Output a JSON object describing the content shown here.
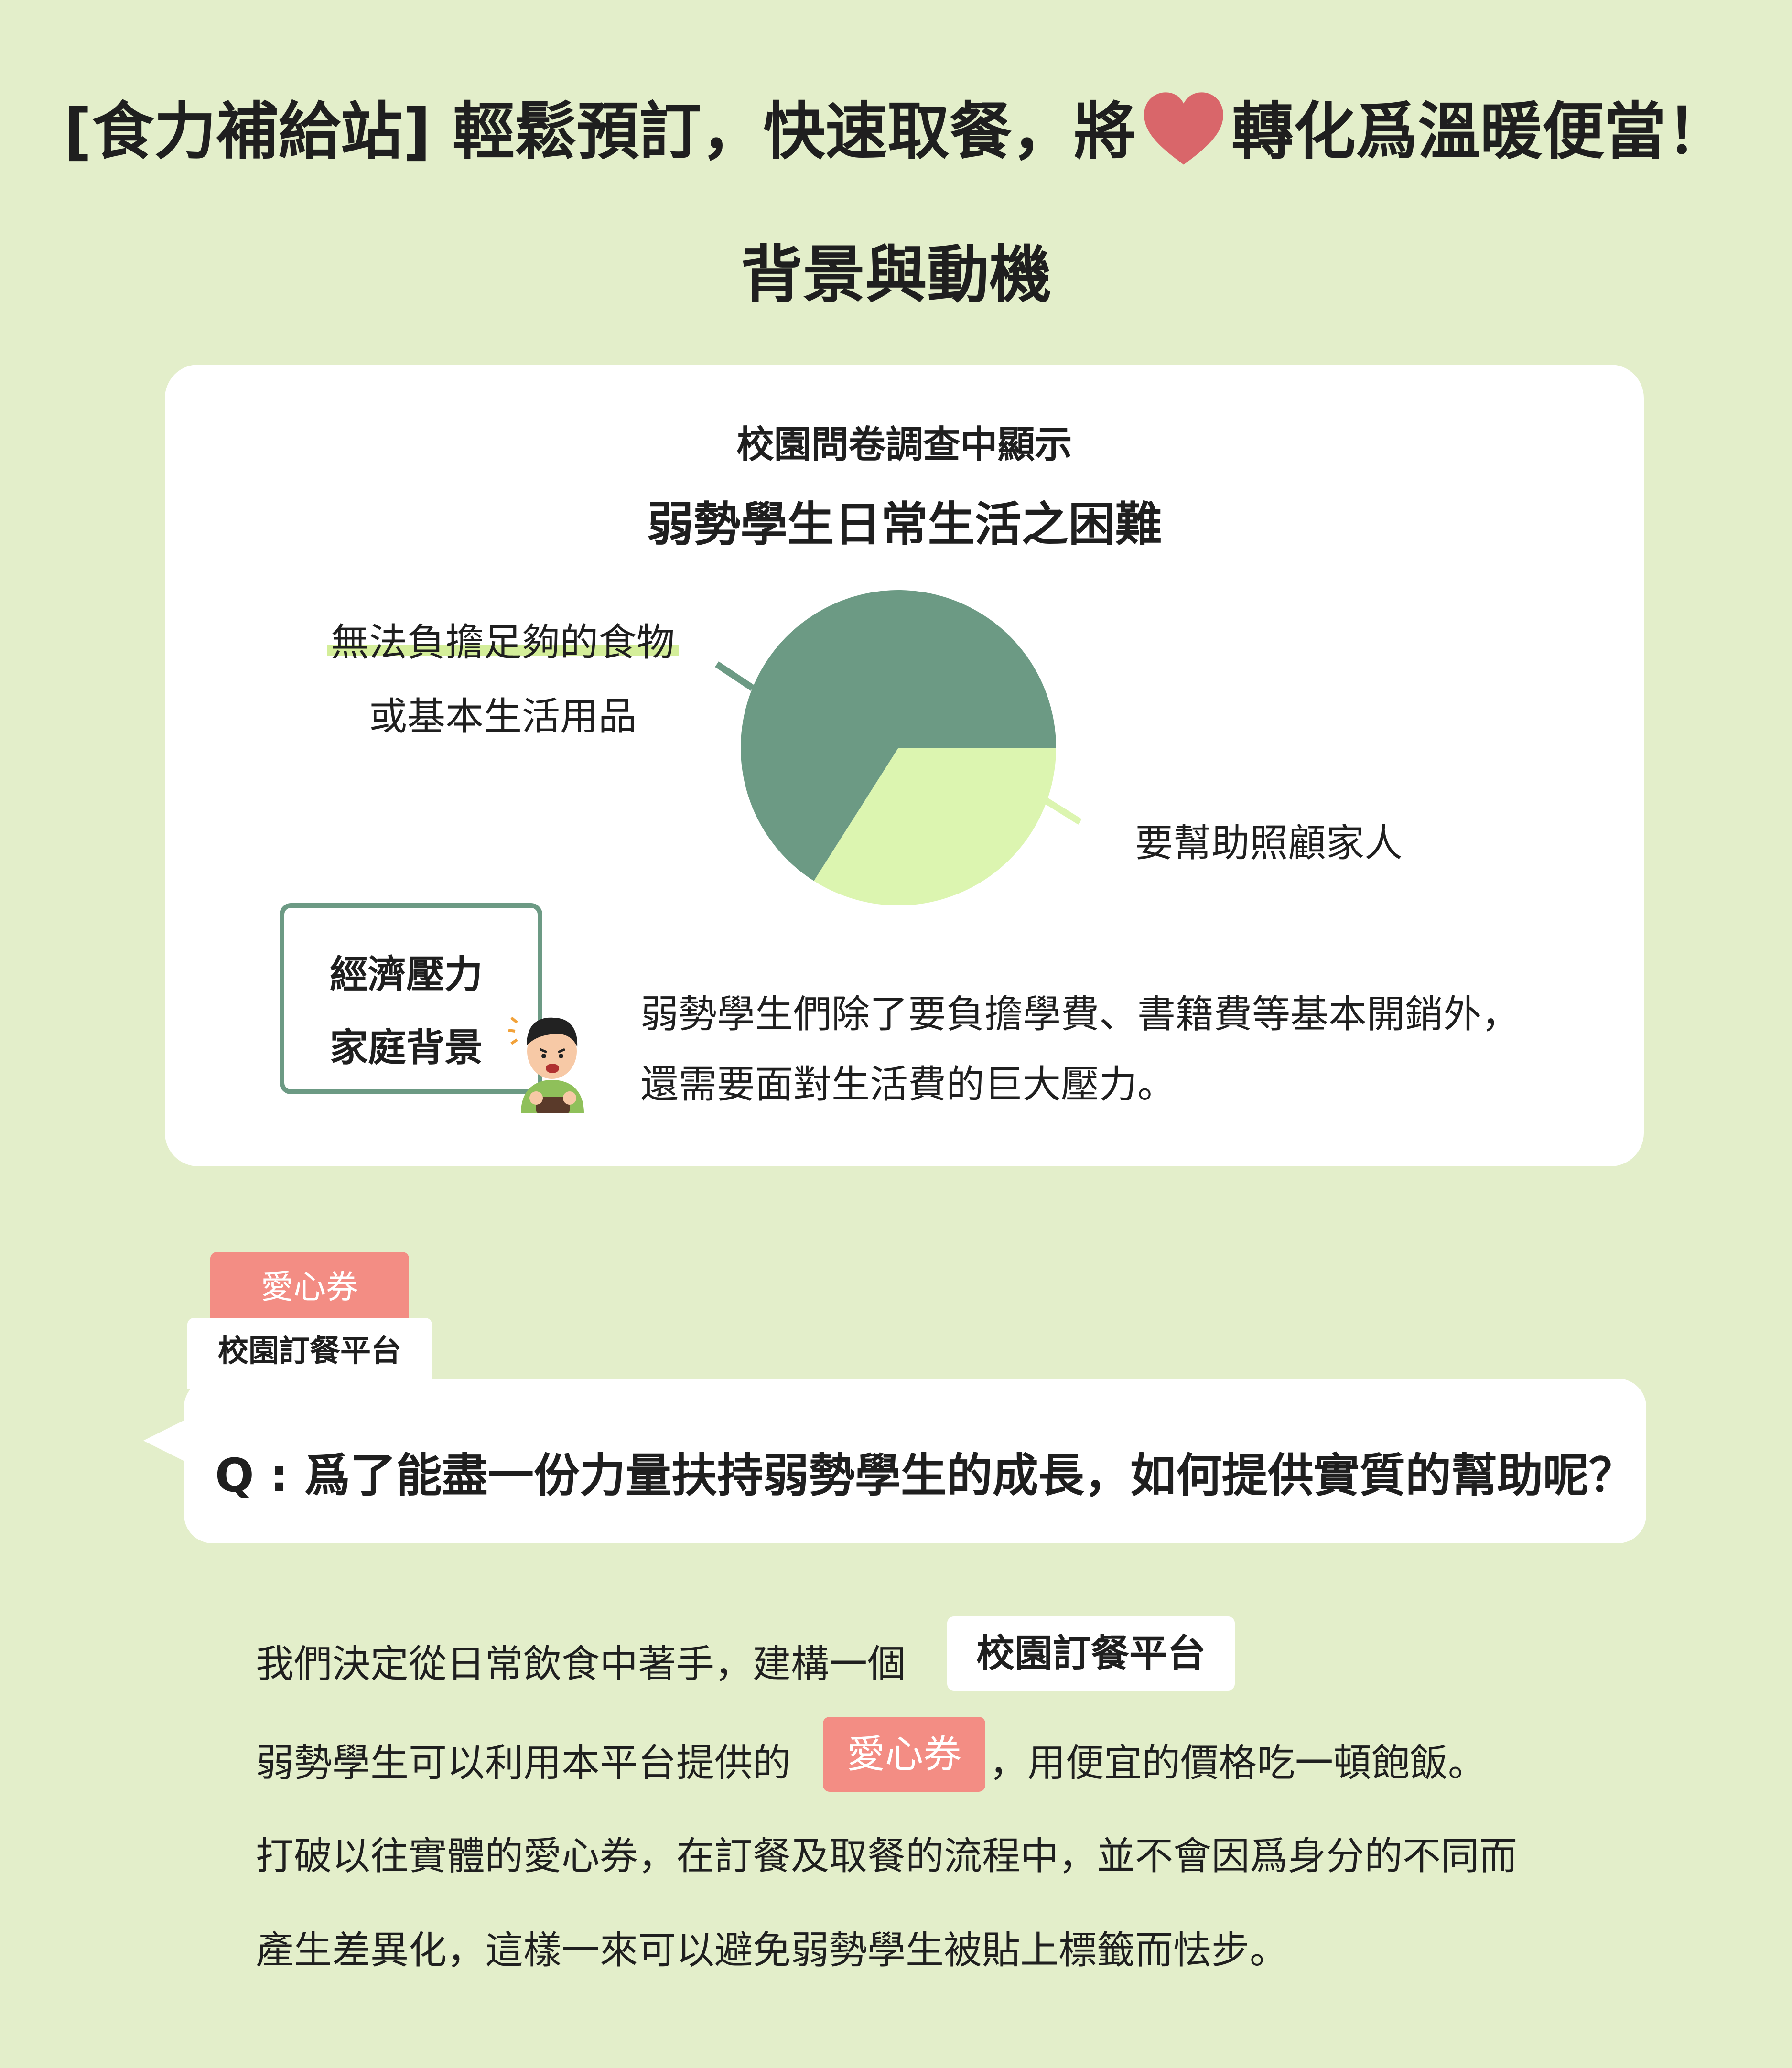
{
  "header": {
    "title_part1": "[食力補給站] 輕鬆預訂，快速取餐，將",
    "title_part2": "轉化爲溫暖便當！",
    "heart_icon": "heart-icon",
    "heart_color": "#d9666a"
  },
  "section": {
    "title": "背景與動機"
  },
  "survey": {
    "line1": "校園問卷調查中顯示",
    "line2": "弱勢學生日常生活之困難",
    "labels": {
      "food_line1": "無法負擔足夠的食物",
      "food_line2": "或基本生活用品",
      "family": "要幫助照顧家人"
    }
  },
  "chart_data": {
    "type": "pie",
    "slices": [
      {
        "label": "無法負擔足夠的食物或基本生活用品",
        "value": 0.66,
        "color": "#6c9a84"
      },
      {
        "label": "要幫助照顧家人",
        "value": 0.34,
        "color": "#dcf5b0"
      }
    ]
  },
  "stress_box": {
    "line1": "經濟壓力",
    "line2": "家庭背景",
    "border_color": "#6c9a84"
  },
  "description": {
    "line1": "弱勢學生們除了要負擔學費、書籍費等基本開銷外，",
    "line2": "還需要面對生活費的巨大壓力。"
  },
  "tags": {
    "voucher": "愛心券",
    "platform": "校園訂餐平台"
  },
  "question": "Q : 爲了能盡一份力量扶持弱勢學生的成長，如何提供實質的幫助呢？",
  "body": {
    "p1": "我們決定從日常飲食中著手，建構一個",
    "chip_platform": "校園訂餐平台",
    "p2a": "弱勢學生可以利用本平台提供的",
    "chip_voucher": "愛心券",
    "p2b": "，用便宜的價格吃一頓飽飯。",
    "p3": "打破以往實體的愛心券，在訂餐及取餐的流程中，並不會因爲身分的不同而",
    "p4": "產生差異化，這樣一來可以避免弱勢學生被貼上標籤而怯步。"
  },
  "colors": {
    "background": "#e3eeca",
    "accent_red": "#f38d84",
    "accent_green": "#6c9a84",
    "light_green": "#dcf5b0"
  }
}
